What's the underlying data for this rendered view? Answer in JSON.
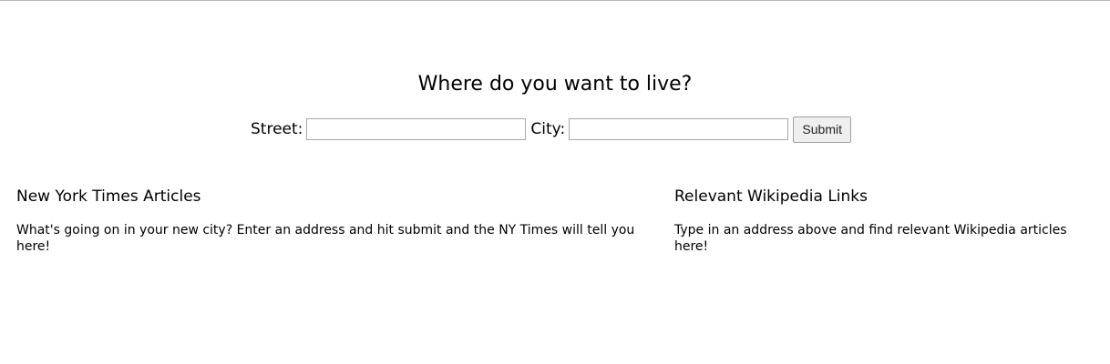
{
  "header": {
    "title": "Where do you want to live?"
  },
  "form": {
    "street_label": "Street:",
    "street_value": "",
    "city_label": "City:",
    "city_value": "",
    "submit_label": "Submit"
  },
  "nyt": {
    "heading": "New York Times Articles",
    "body": "What's going on in your new city? Enter an address and hit submit and the NY Times will tell you here!"
  },
  "wiki": {
    "heading": "Relevant Wikipedia Links",
    "body": "Type in an address above and find relevant Wikipedia articles here!"
  }
}
